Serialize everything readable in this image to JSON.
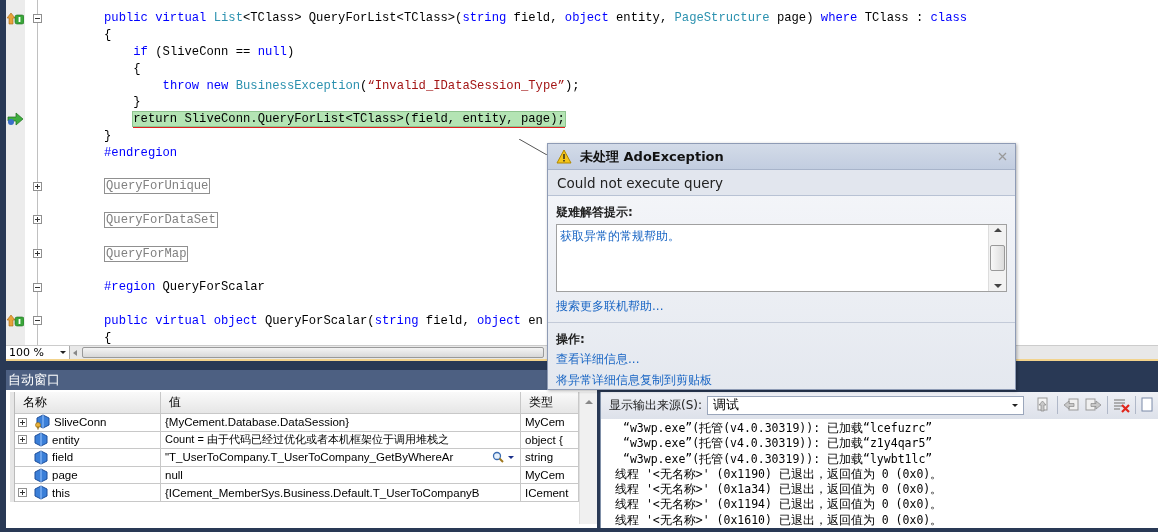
{
  "editor": {
    "lines": [
      {
        "override": true,
        "expanded": true,
        "tokens": [
          {
            "kind": "keyword",
            "text": "public virtual"
          },
          {
            "kind": "type",
            "text": " List"
          },
          {
            "kind": "plain",
            "text": "<TClass> QueryForList<TClass>("
          },
          {
            "kind": "keyword",
            "text": "string"
          },
          {
            "kind": "plain",
            "text": " field, "
          },
          {
            "kind": "keyword",
            "text": "object"
          },
          {
            "kind": "plain",
            "text": " entity, "
          },
          {
            "kind": "type",
            "text": "PageStructure"
          },
          {
            "kind": "plain",
            "text": " page) "
          },
          {
            "kind": "keyword",
            "text": "where"
          },
          {
            "kind": "plain",
            "text": " TClass : "
          },
          {
            "kind": "keyword",
            "text": "class"
          }
        ]
      },
      {
        "tokens": [
          {
            "kind": "plain",
            "text": "{"
          }
        ],
        "children": [
          {
            "tokens": [
              {
                "kind": "keyword",
                "text": "if"
              },
              {
                "kind": "plain",
                "text": " (SliveConn == "
              },
              {
                "kind": "keyword",
                "text": "null"
              },
              {
                "kind": "plain",
                "text": ")"
              }
            ]
          },
          {
            "tokens": [
              {
                "kind": "plain",
                "text": "{"
              }
            ],
            "children": [
              {
                "tokens": [
                  {
                    "kind": "keyword",
                    "text": "throw new"
                  },
                  {
                    "kind": "type",
                    "text": " BusinessException"
                  },
                  {
                    "kind": "plain",
                    "text": "("
                  },
                  {
                    "kind": "string",
                    "text": "“Invalid_IDataSession_Type”"
                  },
                  {
                    "kind": "plain",
                    "text": ");"
                  }
                ]
              }
            ]
          },
          {
            "tokens": [
              {
                "kind": "plain",
                "text": "}"
              }
            ]
          },
          {
            "current": true,
            "tokens": [
              {
                "kind": "plain",
                "text": "return SliveConn.QueryForList<TClass>(field, entity, page);"
              }
            ]
          }
        ]
      },
      {
        "tokens": [
          {
            "kind": "plain",
            "text": "}"
          }
        ]
      },
      {
        "tokens": [
          {
            "kind": "keyword",
            "text": "#endregion"
          }
        ]
      },
      {
        "gap_before": true,
        "expanded": false,
        "collapsed": "QueryForUnique"
      },
      {
        "gap_before": true,
        "expanded": false,
        "collapsed": "QueryForDataSet"
      },
      {
        "gap_before": true,
        "expanded": false,
        "collapsed": "QueryForMap"
      },
      {
        "gap_before": true,
        "expanded": true,
        "tokens": [
          {
            "kind": "keyword",
            "text": "#region"
          },
          {
            "kind": "plain",
            "text": " QueryForScalar"
          }
        ]
      },
      {
        "gap_before": true,
        "override": true,
        "expanded": true,
        "tokens": [
          {
            "kind": "keyword",
            "text": "public virtual object"
          },
          {
            "kind": "plain",
            "text": " QueryForScalar("
          },
          {
            "kind": "keyword",
            "text": "string"
          },
          {
            "kind": "plain",
            "text": " field, "
          },
          {
            "kind": "keyword",
            "text": "object"
          },
          {
            "kind": "plain",
            "text": " en"
          }
        ]
      },
      {
        "tokens": [
          {
            "kind": "plain",
            "text": "{"
          }
        ]
      }
    ],
    "zoom": "100 %"
  },
  "exception_popup": {
    "title": "未处理 AdoException",
    "message": "Could not execute query",
    "troubleshooting_heading": "疑难解答提示:",
    "tips": [
      "获取异常的常规帮助。"
    ],
    "search_link": "搜索更多联机帮助...",
    "actions_heading": "操作:",
    "actions": [
      "查看详细信息...",
      "将异常详细信息复制到剪贴板"
    ]
  },
  "autos": {
    "title": "自动窗口",
    "columns": [
      "名称",
      "值",
      "类型"
    ],
    "rows": [
      {
        "kind": "field",
        "name": "SliveConn",
        "value": "{MyCement.Database.DataSession}",
        "type": "MyCem",
        "expandable": true
      },
      {
        "kind": "local",
        "name": "entity",
        "value": "Count = 由于代码已经过优化或者本机框架位于调用堆栈之",
        "type": "object {",
        "expandable": true
      },
      {
        "kind": "local",
        "name": "field",
        "value": "\"T_UserToCompany.T_UserToCompany_GetByWhereAr",
        "type": "string",
        "expandable": false,
        "visualizer": true
      },
      {
        "kind": "local",
        "name": "page",
        "value": "null",
        "type": "MyCem",
        "expandable": false
      },
      {
        "kind": "local",
        "name": "this",
        "value": "{ICement_MemberSys.Business.Default.T_UserToCompanyB",
        "type": "ICement",
        "expandable": true
      }
    ]
  },
  "output": {
    "source_label": "显示输出来源(S):",
    "source": "调试",
    "lines": [
      "“w3wp.exe”(托管(v4.0.30319)): 已加载“lcefuzrc”",
      "“w3wp.exe”(托管(v4.0.30319)): 已加载“z1y4qar5”",
      "“w3wp.exe”(托管(v4.0.30319)): 已加载“lywbt1lc”",
      "线程 '<无名称>' (0x1190) 已退出，返回值为 0 (0x0)。",
      "线程 '<无名称>' (0x1a34) 已退出，返回值为 0 (0x0)。",
      "线程 '<无名称>' (0x1194) 已退出，返回值为 0 (0x0)。",
      "线程 '<无名称>' (0x1610) 已退出，返回值为 0 (0x0)。"
    ]
  }
}
